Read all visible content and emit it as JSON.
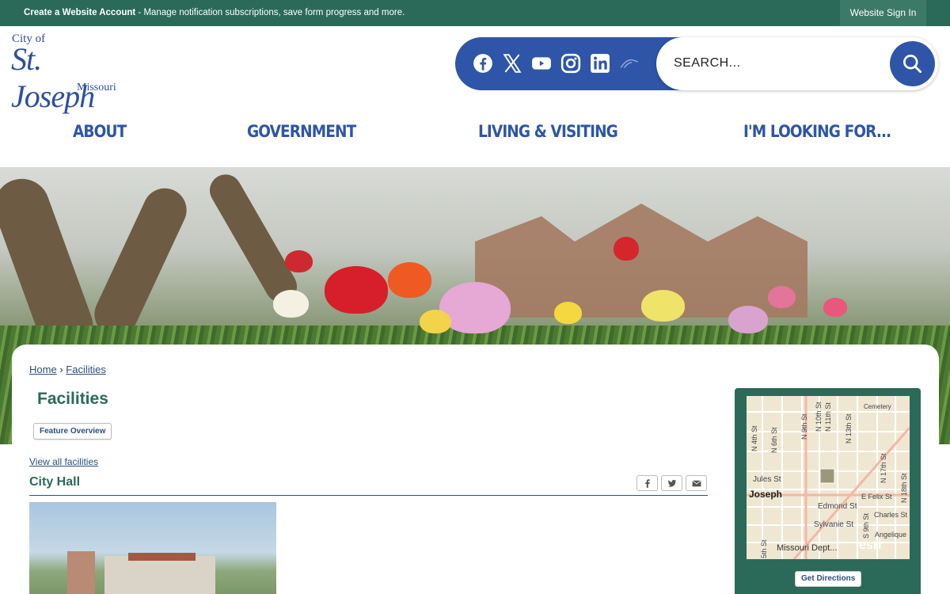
{
  "topbar": {
    "account_link": "Create a Website Account",
    "account_text": " - Manage notification subscriptions, save form progress and more.",
    "signin": "Website Sign In"
  },
  "logo": {
    "city": "City of",
    "name": "St. Joseph",
    "state": "Missouri"
  },
  "social": [
    "facebook-icon",
    "x-icon",
    "youtube-icon",
    "instagram-icon",
    "linkedin-icon",
    "nextdoor-icon"
  ],
  "search": {
    "placeholder": "SEARCH..."
  },
  "nav": [
    "ABOUT",
    "GOVERNMENT",
    "LIVING & VISITING",
    "I'M LOOKING FOR..."
  ],
  "breadcrumb": {
    "home": "Home",
    "sep": "›",
    "current": "Facilities"
  },
  "page": {
    "title": "Facilities",
    "feature_button": "Feature Overview",
    "view_all": "View all facilities",
    "facility_title": "City Hall"
  },
  "share": [
    "facebook-share-icon",
    "twitter-share-icon",
    "email-share-icon"
  ],
  "map": {
    "labels": [
      "Jules St",
      "Joseph",
      "Edmond St",
      "E Felix St",
      "Charles St",
      "Sylvanie St",
      "Angelique",
      "Missouri Dept...",
      "esri",
      "Cemetery"
    ],
    "street_labels": [
      "N 4th St",
      "N 6th St",
      "N 9th St",
      "N 10th St",
      "N 11th St",
      "N 13th St",
      "N 17th St",
      "N 18th St",
      "5th St",
      "S 9th St"
    ],
    "directions": "Get Directions"
  },
  "colors": {
    "green": "#2b6a58",
    "blue": "#2e55a8",
    "link": "#2d4f7a"
  }
}
